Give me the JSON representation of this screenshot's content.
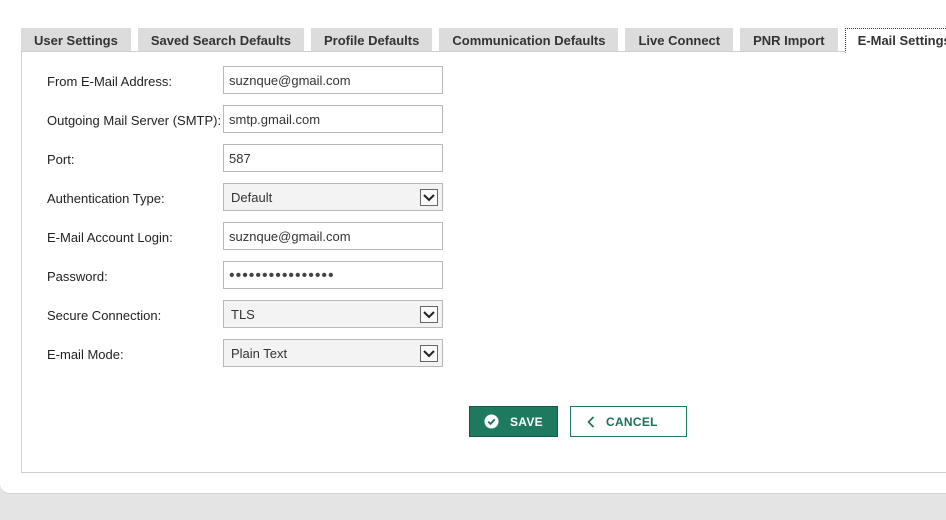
{
  "tabs": [
    {
      "label": "User Settings",
      "active": false
    },
    {
      "label": "Saved Search Defaults",
      "active": false
    },
    {
      "label": "Profile Defaults",
      "active": false
    },
    {
      "label": "Communication Defaults",
      "active": false
    },
    {
      "label": "Live Connect",
      "active": false
    },
    {
      "label": "PNR Import",
      "active": false
    },
    {
      "label": "E-Mail Settings",
      "active": true
    }
  ],
  "form": {
    "from_email": {
      "label": "From E-Mail Address:",
      "value": "suznque@gmail.com"
    },
    "smtp": {
      "label": "Outgoing Mail Server (SMTP):",
      "value": "smtp.gmail.com"
    },
    "port": {
      "label": "Port:",
      "value": "587"
    },
    "auth_type": {
      "label": "Authentication Type:",
      "value": "Default"
    },
    "login": {
      "label": "E-Mail Account Login:",
      "value": "suznque@gmail.com"
    },
    "password": {
      "label": "Password:",
      "value": "••••••••••••••••"
    },
    "secure": {
      "label": "Secure Connection:",
      "value": "TLS"
    },
    "mode": {
      "label": "E-mail Mode:",
      "value": "Plain Text"
    }
  },
  "buttons": {
    "save_label": "SAVE",
    "cancel_label": "CANCEL"
  },
  "colors": {
    "accent": "#1e7a5f",
    "tab_bg": "#dcdcdc",
    "page_bg": "#e4e4e4"
  },
  "icons": {
    "save": "check-circle-icon",
    "cancel": "chevron-left-icon",
    "select_arrow": "chevron-down-icon"
  }
}
